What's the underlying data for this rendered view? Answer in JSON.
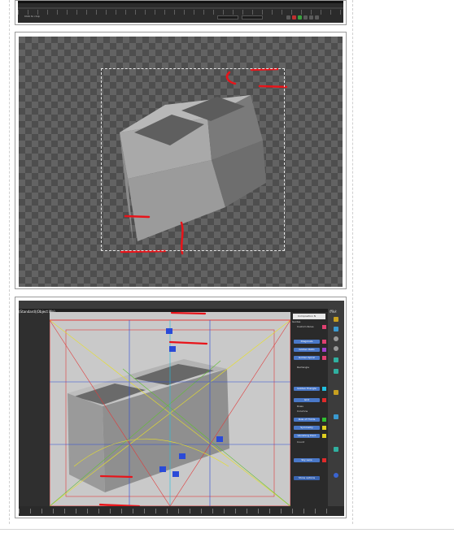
{
  "colors": {
    "accent_red": "#e8141a",
    "panel_blue": "#4a78c8",
    "swatch_pink": "#e04070",
    "swatch_purple": "#a040d0",
    "swatch_cyan": "#20c0e0",
    "swatch_red": "#e02a2a",
    "swatch_green": "#30c030",
    "swatch_yellow": "#e0d020",
    "guide_yellow": "#e8e028",
    "guide_blue": "#2a4ad8",
    "guide_red": "#e03a3a",
    "guide_green": "#60c030"
  },
  "frame1": {
    "status_text": "Click to crop",
    "icons": [
      "play-icon",
      "record-icon",
      "key-icon"
    ]
  },
  "frame3": {
    "viewport_label": "(Standard)(Object Mo)",
    "panel_title": "Composition N",
    "panel_section": "Guides",
    "panel_rows": [
      "Custom Rules",
      "Diagonals",
      "Golden Ratio",
      "Golden Spiral",
      "Rectangle",
      "Golden Triangle",
      "Grid",
      "Rule of Thirds",
      "Symmetry",
      "Vanishing Point",
      "Sky Lens"
    ],
    "panel_small_rows": [
      "Rows",
      "Columns",
      "Count"
    ],
    "panel_footer": "Show options",
    "brand_label": "ffikk",
    "tool_icons": [
      "layers-icon",
      "settings-icon",
      "target-icon",
      "grid-icon",
      "light-icon",
      "eye-icon",
      "camera-icon"
    ]
  }
}
